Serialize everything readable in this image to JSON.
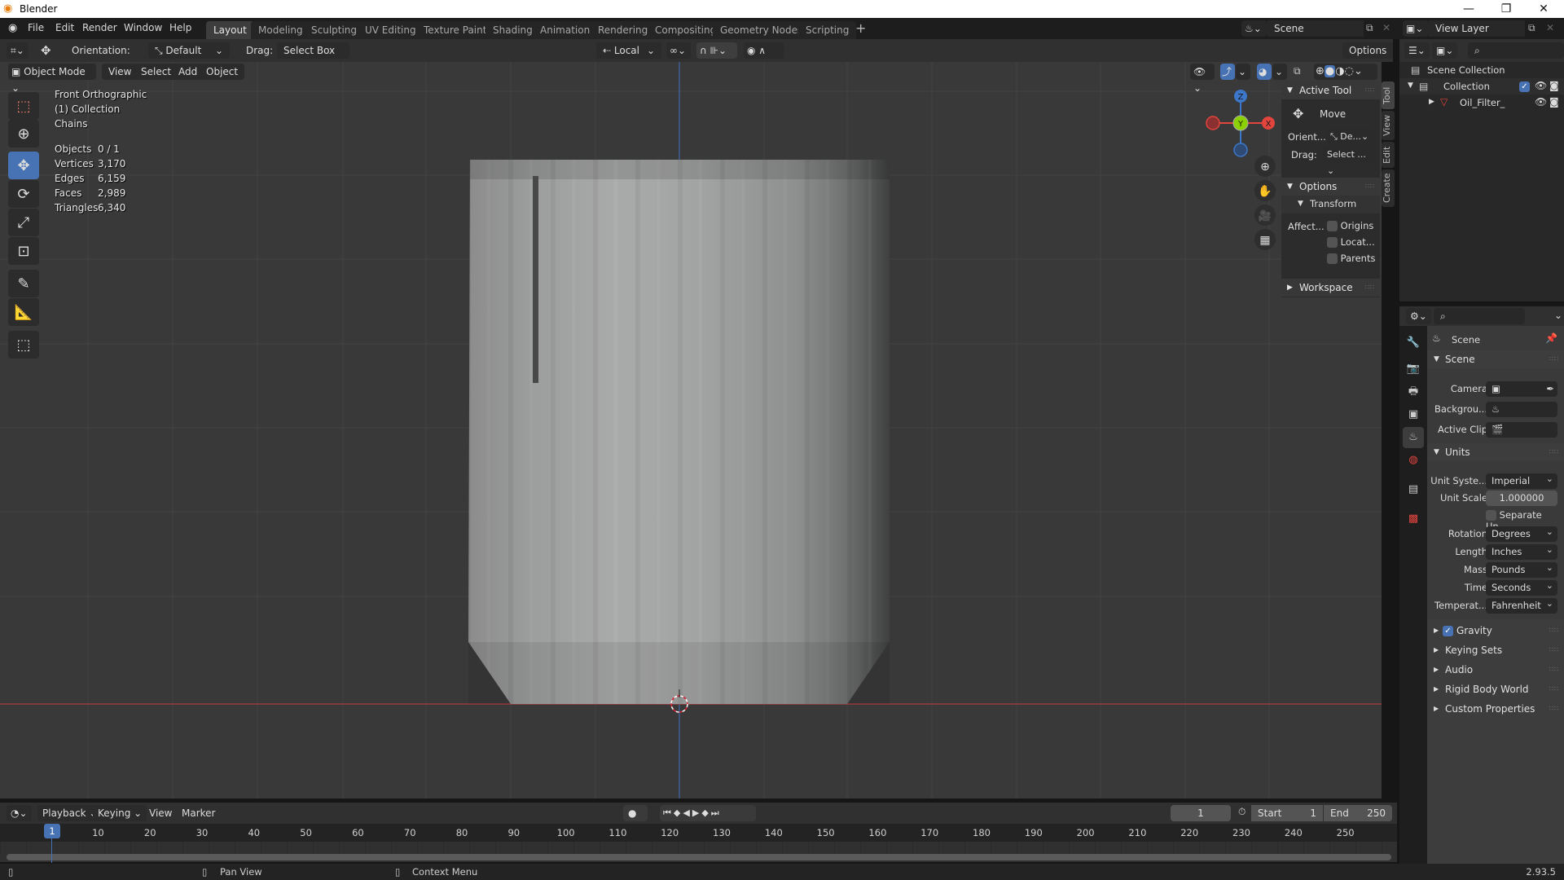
{
  "window": {
    "title": "Blender",
    "controls": [
      "minimize",
      "restore",
      "close"
    ]
  },
  "menus": [
    "File",
    "Edit",
    "Render",
    "Window",
    "Help"
  ],
  "workspaces": [
    {
      "label": "Layout",
      "active": true
    },
    {
      "label": "Modeling"
    },
    {
      "label": "Sculpting"
    },
    {
      "label": "UV Editing"
    },
    {
      "label": "Texture Paint"
    },
    {
      "label": "Shading"
    },
    {
      "label": "Animation"
    },
    {
      "label": "Rendering"
    },
    {
      "label": "Compositing"
    },
    {
      "label": "Geometry Nodes"
    },
    {
      "label": "Scripting"
    }
  ],
  "add_workspace": "+",
  "scene_selector": {
    "value": "Scene"
  },
  "view_layer_selector": {
    "value": "View Layer"
  },
  "tool_settings": {
    "orientation_label": "Orientation:",
    "orientation_value": "Default",
    "drag_label": "Drag:",
    "drag_value": "Select Box",
    "pivot_value": "Local",
    "options_label": "Options"
  },
  "viewport_header": {
    "mode": "Object Mode",
    "menus": [
      "View",
      "Select",
      "Add",
      "Object"
    ]
  },
  "viewport_info": {
    "view_name": "Front Orthographic",
    "collection": "(1) Collection",
    "object_name": "Chains",
    "stats": [
      {
        "label": "Objects",
        "value": "0 / 1"
      },
      {
        "label": "Vertices",
        "value": "3,170"
      },
      {
        "label": "Edges",
        "value": "6,159"
      },
      {
        "label": "Faces",
        "value": "2,989"
      },
      {
        "label": "Triangles",
        "value": "6,340"
      }
    ]
  },
  "gizmo": {
    "z": "Z",
    "y": "Y",
    "x": "X",
    "colors": {
      "x": "#e2443e",
      "y": "#8bd100",
      "z": "#3c77c9"
    }
  },
  "toolbar": [
    "select-box",
    "cursor",
    "move",
    "rotate",
    "scale",
    "transform",
    "annotate",
    "measure",
    "add-cube"
  ],
  "npanel": {
    "tabs": [
      "Tool",
      "View",
      "Edit",
      "Create"
    ],
    "active_tool_header": "Active Tool",
    "tool_name": "Move",
    "orient_label": "Orient...",
    "orient_value": "De...",
    "drag_label": "Drag:",
    "drag_value": "Select ...",
    "options_header": "Options",
    "transform_header": "Transform",
    "affect_label": "Affect...",
    "affect_options": [
      {
        "label": "Origins",
        "checked": false
      },
      {
        "label": "Locat...",
        "checked": false
      },
      {
        "label": "Parents",
        "checked": false
      }
    ],
    "workspace_header": "Workspace"
  },
  "outliner": {
    "search_placeholder": "",
    "items": [
      {
        "label": "Scene Collection",
        "level": 0
      },
      {
        "label": "Collection",
        "level": 1,
        "checked": true
      },
      {
        "label": "Oil_Filter_",
        "level": 2
      }
    ]
  },
  "properties": {
    "search_placeholder": "",
    "context": "Scene",
    "scene_panel": {
      "header": "Scene",
      "camera_label": "Camera",
      "background_label": "Backgrou...",
      "active_clip_label": "Active Clip"
    },
    "units_panel": {
      "header": "Units",
      "rows": [
        {
          "label": "Unit Syste...",
          "value": "Imperial"
        },
        {
          "label": "Unit Scale",
          "value": "1.000000"
        }
      ],
      "separate_units": {
        "label": "Separate Un...",
        "checked": false
      },
      "rows2": [
        {
          "label": "Rotation",
          "value": "Degrees"
        },
        {
          "label": "Length",
          "value": "Inches"
        },
        {
          "label": "Mass",
          "value": "Pounds"
        },
        {
          "label": "Time",
          "value": "Seconds"
        },
        {
          "label": "Temperat...",
          "value": "Fahrenheit"
        }
      ]
    },
    "collapsed_panels": [
      {
        "label": "Gravity",
        "checked": true
      },
      {
        "label": "Keying Sets"
      },
      {
        "label": "Audio"
      },
      {
        "label": "Rigid Body World"
      },
      {
        "label": "Custom Properties"
      }
    ]
  },
  "timeline": {
    "menus": [
      "Playback",
      "Keying",
      "View",
      "Marker"
    ],
    "current_frame": "1",
    "start_label": "Start",
    "start_value": "1",
    "end_label": "End",
    "end_value": "250",
    "ticks": [
      "10",
      "20",
      "30",
      "40",
      "50",
      "60",
      "70",
      "80",
      "90",
      "100",
      "110",
      "120",
      "130",
      "140",
      "150",
      "160",
      "170",
      "180",
      "190",
      "200",
      "210",
      "220",
      "230",
      "240",
      "250"
    ],
    "playhead": "1"
  },
  "statusbar": {
    "pan_view": "Pan View",
    "context_menu": "Context Menu",
    "version": "2.93.5"
  }
}
